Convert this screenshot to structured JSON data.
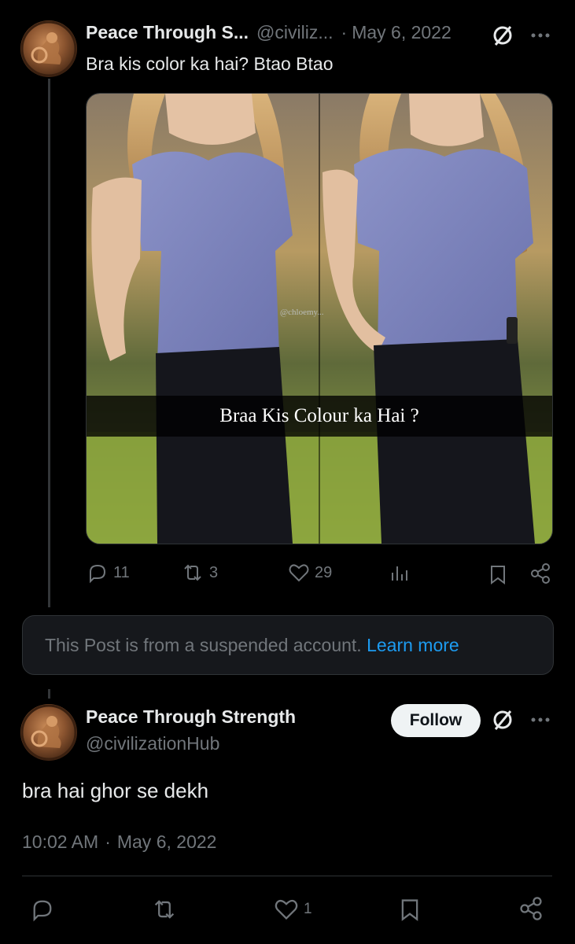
{
  "quoted_post": {
    "author_name": "Peace Through S...",
    "handle": "@civiliz...",
    "separator": "·",
    "date": "May 6, 2022",
    "text": "Bra kis color ka hai? Btao Btao",
    "media_caption": "Braa Kis Colour ka Hai ?",
    "media_watermark": "@chloemy...",
    "stats": {
      "replies": "11",
      "reposts": "3",
      "likes": "29"
    }
  },
  "suspended_notice": {
    "text": "This Post is from a suspended account.",
    "link": "Learn more"
  },
  "main_post": {
    "author_name": "Peace Through Strength",
    "handle": "@civilizationHub",
    "follow_label": "Follow",
    "text": "bra hai ghor se dekh",
    "time": "10:02 AM",
    "separator": "·",
    "date": "May 6, 2022",
    "stats": {
      "likes": "1"
    }
  },
  "colors": {
    "background": "#000000",
    "text": "#e7e9ea",
    "muted": "#71767b",
    "link": "#1d9bf0",
    "border": "#2f3336"
  },
  "icons": [
    "grok-slash-icon",
    "more-icon",
    "reply-icon",
    "repost-icon",
    "like-icon",
    "views-icon",
    "bookmark-icon",
    "share-icon"
  ]
}
